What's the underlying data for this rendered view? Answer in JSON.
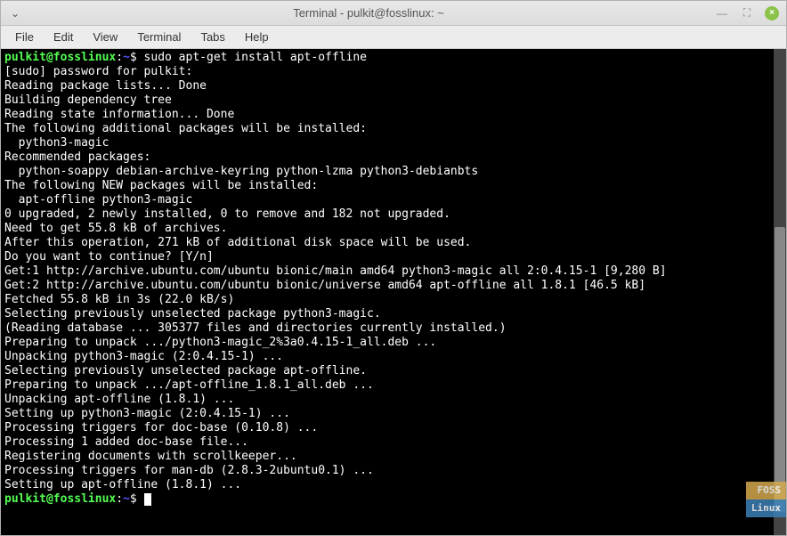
{
  "window": {
    "title": "Terminal - pulkit@fosslinux: ~"
  },
  "menu": {
    "file": "File",
    "edit": "Edit",
    "view": "View",
    "terminal": "Terminal",
    "tabs": "Tabs",
    "help": "Help"
  },
  "prompt": {
    "user_host": "pulkit@fosslinux",
    "colon": ":",
    "path": "~",
    "symbol": "$ "
  },
  "command": "sudo apt-get install apt-offline",
  "output_lines": [
    "[sudo] password for pulkit: ",
    "Reading package lists... Done",
    "Building dependency tree       ",
    "Reading state information... Done",
    "The following additional packages will be installed:",
    "  python3-magic",
    "Recommended packages:",
    "  python-soappy debian-archive-keyring python-lzma python3-debianbts",
    "The following NEW packages will be installed:",
    "  apt-offline python3-magic",
    "0 upgraded, 2 newly installed, 0 to remove and 182 not upgraded.",
    "Need to get 55.8 kB of archives.",
    "After this operation, 271 kB of additional disk space will be used.",
    "Do you want to continue? [Y/n] ",
    "Get:1 http://archive.ubuntu.com/ubuntu bionic/main amd64 python3-magic all 2:0.4.15-1 [9,280 B]",
    "Get:2 http://archive.ubuntu.com/ubuntu bionic/universe amd64 apt-offline all 1.8.1 [46.5 kB]",
    "Fetched 55.8 kB in 3s (22.0 kB/s)      ",
    "Selecting previously unselected package python3-magic.",
    "(Reading database ... 305377 files and directories currently installed.)",
    "Preparing to unpack .../python3-magic_2%3a0.4.15-1_all.deb ...",
    "Unpacking python3-magic (2:0.4.15-1) ...",
    "Selecting previously unselected package apt-offline.",
    "Preparing to unpack .../apt-offline_1.8.1_all.deb ...",
    "Unpacking apt-offline (1.8.1) ...",
    "Setting up python3-magic (2:0.4.15-1) ...",
    "Processing triggers for doc-base (0.10.8) ...",
    "Processing 1 added doc-base file...",
    "Registering documents with scrollkeeper...",
    "Processing triggers for man-db (2.8.3-2ubuntu0.1) ...",
    "Setting up apt-offline (1.8.1) ..."
  ],
  "watermark": {
    "line1": "FOSS",
    "line2": "Linux"
  }
}
